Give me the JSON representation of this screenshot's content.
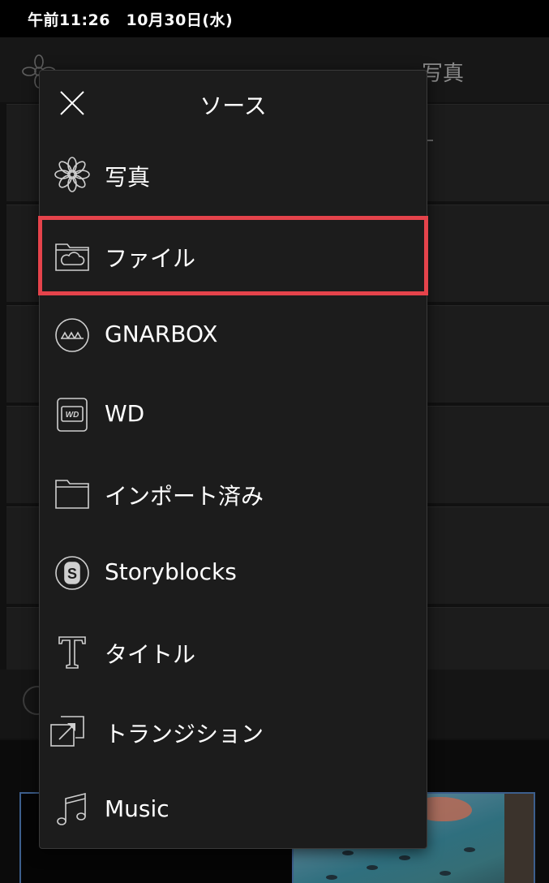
{
  "status_bar": {
    "time_date": "午前11:26　10月30日(水)"
  },
  "background": {
    "header_title": "写真"
  },
  "menu": {
    "title": "ソース",
    "items": [
      {
        "label": "写真",
        "icon": "flower-icon"
      },
      {
        "label": "ファイル",
        "icon": "folder-cloud-icon",
        "highlighted": true
      },
      {
        "label": "GNARBOX",
        "icon": "gnarbox-icon"
      },
      {
        "label": "WD",
        "icon": "wd-drive-icon"
      },
      {
        "label": "インポート済み",
        "icon": "folder-icon"
      },
      {
        "label": "Storyblocks",
        "icon": "storyblocks-icon"
      },
      {
        "label": "タイトル",
        "icon": "title-t-icon"
      },
      {
        "label": "トランジション",
        "icon": "transition-icon"
      },
      {
        "label": "Music",
        "icon": "music-note-icon"
      }
    ]
  },
  "colors": {
    "highlight": "#e5434b",
    "menu_bg": "#1c1c1c",
    "clip_border": "#3d5f8d"
  }
}
